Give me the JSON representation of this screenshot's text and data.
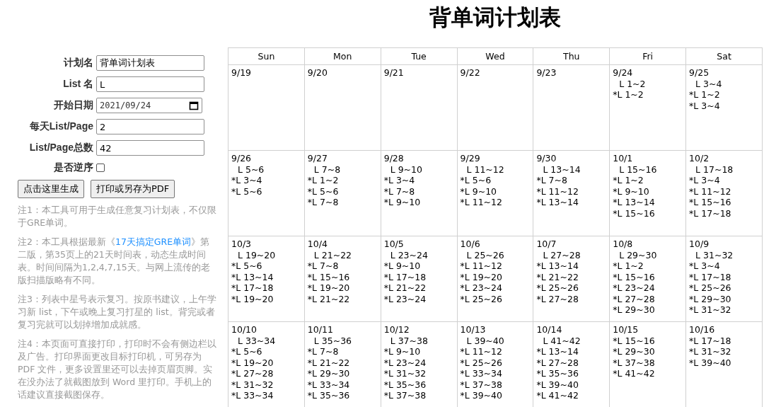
{
  "title": "背单词计划表",
  "form": {
    "fields": [
      {
        "label": "计划名",
        "kind": "text",
        "value": "背单词计划表"
      },
      {
        "label": "List 名",
        "kind": "text",
        "value": "L"
      },
      {
        "label": "开始日期",
        "kind": "date",
        "value": "2021/09/24"
      },
      {
        "label": "每天List/Page",
        "kind": "text",
        "value": "2"
      },
      {
        "label": "List/Page总数",
        "kind": "text",
        "value": "42"
      },
      {
        "label": "是否逆序",
        "kind": "checkbox",
        "checked": false
      }
    ],
    "buttons": [
      "点击这里生成",
      "打印或另存为PDF"
    ]
  },
  "notes": [
    {
      "parts": [
        {
          "kind": "text",
          "text": "注1：本工具可用于生成任意复习计划表，不仅限于GRE单词。"
        }
      ]
    },
    {
      "parts": [
        {
          "kind": "text",
          "text": "注2：本工具根据最新《"
        },
        {
          "kind": "link",
          "text": "17天搞定GRE单词"
        },
        {
          "kind": "text",
          "text": "》第二版，第35页上的21天时间表，动态生成时间表。时间间隔为1,2,4,7,15天。与网上流传的老版扫描版略有不同。"
        }
      ]
    },
    {
      "parts": [
        {
          "kind": "text",
          "text": "注3：列表中星号表示复习。按原书建议，上午学习新 list，下午或晚上复习打星的 list。背完或者复习完就可以划掉增加成就感。"
        }
      ]
    },
    {
      "parts": [
        {
          "kind": "text",
          "text": "注4：本页面可直接打印，打印时不会有侧边栏以及广告。打印界面更改目标打印机，可另存为 PDF 文件，更多设置里还可以去掉页眉页脚。实在没办法了就截图放到 Word 里打印。手机上的话建议直接截图保存。"
        }
      ]
    }
  ],
  "calendar": {
    "columns": [
      "Sun",
      "Mon",
      "Tue",
      "Wed",
      "Thu",
      "Fri",
      "Sat"
    ],
    "weeks": [
      [
        {
          "date": "9/19"
        },
        {
          "date": "9/20"
        },
        {
          "date": "9/21"
        },
        {
          "date": "9/22"
        },
        {
          "date": "9/23"
        },
        {
          "date": "9/24",
          "entries": [
            {
              "kind": "new",
              "text": "L 1~2"
            },
            {
              "kind": "review",
              "text": "*L 1~2"
            }
          ]
        },
        {
          "date": "9/25",
          "entries": [
            {
              "kind": "new",
              "text": "L 3~4"
            },
            {
              "kind": "review",
              "text": "*L 1~2"
            },
            {
              "kind": "review",
              "text": "*L 3~4"
            }
          ]
        }
      ],
      [
        {
          "date": "9/26",
          "entries": [
            {
              "kind": "new",
              "text": "L 5~6"
            },
            {
              "kind": "review",
              "text": "*L 3~4"
            },
            {
              "kind": "review",
              "text": "*L 5~6"
            }
          ]
        },
        {
          "date": "9/27",
          "entries": [
            {
              "kind": "new",
              "text": "L 7~8"
            },
            {
              "kind": "review",
              "text": "*L 1~2"
            },
            {
              "kind": "review",
              "text": "*L 5~6"
            },
            {
              "kind": "review",
              "text": "*L 7~8"
            }
          ]
        },
        {
          "date": "9/28",
          "entries": [
            {
              "kind": "new",
              "text": "L 9~10"
            },
            {
              "kind": "review",
              "text": "*L 3~4"
            },
            {
              "kind": "review",
              "text": "*L 7~8"
            },
            {
              "kind": "review",
              "text": "*L 9~10"
            }
          ]
        },
        {
          "date": "9/29",
          "entries": [
            {
              "kind": "new",
              "text": "L 11~12"
            },
            {
              "kind": "review",
              "text": "*L 5~6"
            },
            {
              "kind": "review",
              "text": "*L 9~10"
            },
            {
              "kind": "review",
              "text": "*L 11~12"
            }
          ]
        },
        {
          "date": "9/30",
          "entries": [
            {
              "kind": "new",
              "text": "L 13~14"
            },
            {
              "kind": "review",
              "text": "*L 7~8"
            },
            {
              "kind": "review",
              "text": "*L 11~12"
            },
            {
              "kind": "review",
              "text": "*L 13~14"
            }
          ]
        },
        {
          "date": "10/1",
          "entries": [
            {
              "kind": "new",
              "text": "L 15~16"
            },
            {
              "kind": "review",
              "text": "*L 1~2"
            },
            {
              "kind": "review",
              "text": "*L 9~10"
            },
            {
              "kind": "review",
              "text": "*L 13~14"
            },
            {
              "kind": "review",
              "text": "*L 15~16"
            }
          ]
        },
        {
          "date": "10/2",
          "entries": [
            {
              "kind": "new",
              "text": "L 17~18"
            },
            {
              "kind": "review",
              "text": "*L 3~4"
            },
            {
              "kind": "review",
              "text": "*L 11~12"
            },
            {
              "kind": "review",
              "text": "*L 15~16"
            },
            {
              "kind": "review",
              "text": "*L 17~18"
            }
          ]
        }
      ],
      [
        {
          "date": "10/3",
          "entries": [
            {
              "kind": "new",
              "text": "L 19~20"
            },
            {
              "kind": "review",
              "text": "*L 5~6"
            },
            {
              "kind": "review",
              "text": "*L 13~14"
            },
            {
              "kind": "review",
              "text": "*L 17~18"
            },
            {
              "kind": "review",
              "text": "*L 19~20"
            }
          ]
        },
        {
          "date": "10/4",
          "entries": [
            {
              "kind": "new",
              "text": "L 21~22"
            },
            {
              "kind": "review",
              "text": "*L 7~8"
            },
            {
              "kind": "review",
              "text": "*L 15~16"
            },
            {
              "kind": "review",
              "text": "*L 19~20"
            },
            {
              "kind": "review",
              "text": "*L 21~22"
            }
          ]
        },
        {
          "date": "10/5",
          "entries": [
            {
              "kind": "new",
              "text": "L 23~24"
            },
            {
              "kind": "review",
              "text": "*L 9~10"
            },
            {
              "kind": "review",
              "text": "*L 17~18"
            },
            {
              "kind": "review",
              "text": "*L 21~22"
            },
            {
              "kind": "review",
              "text": "*L 23~24"
            }
          ]
        },
        {
          "date": "10/6",
          "entries": [
            {
              "kind": "new",
              "text": "L 25~26"
            },
            {
              "kind": "review",
              "text": "*L 11~12"
            },
            {
              "kind": "review",
              "text": "*L 19~20"
            },
            {
              "kind": "review",
              "text": "*L 23~24"
            },
            {
              "kind": "review",
              "text": "*L 25~26"
            }
          ]
        },
        {
          "date": "10/7",
          "entries": [
            {
              "kind": "new",
              "text": "L 27~28"
            },
            {
              "kind": "review",
              "text": "*L 13~14"
            },
            {
              "kind": "review",
              "text": "*L 21~22"
            },
            {
              "kind": "review",
              "text": "*L 25~26"
            },
            {
              "kind": "review",
              "text": "*L 27~28"
            }
          ]
        },
        {
          "date": "10/8",
          "entries": [
            {
              "kind": "new",
              "text": "L 29~30"
            },
            {
              "kind": "review",
              "text": "*L 1~2"
            },
            {
              "kind": "review",
              "text": "*L 15~16"
            },
            {
              "kind": "review",
              "text": "*L 23~24"
            },
            {
              "kind": "review",
              "text": "*L 27~28"
            },
            {
              "kind": "review",
              "text": "*L 29~30"
            }
          ]
        },
        {
          "date": "10/9",
          "entries": [
            {
              "kind": "new",
              "text": "L 31~32"
            },
            {
              "kind": "review",
              "text": "*L 3~4"
            },
            {
              "kind": "review",
              "text": "*L 17~18"
            },
            {
              "kind": "review",
              "text": "*L 25~26"
            },
            {
              "kind": "review",
              "text": "*L 29~30"
            },
            {
              "kind": "review",
              "text": "*L 31~32"
            }
          ]
        }
      ],
      [
        {
          "date": "10/10",
          "entries": [
            {
              "kind": "new",
              "text": "L 33~34"
            },
            {
              "kind": "review",
              "text": "*L 5~6"
            },
            {
              "kind": "review",
              "text": "*L 19~20"
            },
            {
              "kind": "review",
              "text": "*L 27~28"
            },
            {
              "kind": "review",
              "text": "*L 31~32"
            },
            {
              "kind": "review",
              "text": "*L 33~34"
            }
          ]
        },
        {
          "date": "10/11",
          "entries": [
            {
              "kind": "new",
              "text": "L 35~36"
            },
            {
              "kind": "review",
              "text": "*L 7~8"
            },
            {
              "kind": "review",
              "text": "*L 21~22"
            },
            {
              "kind": "review",
              "text": "*L 29~30"
            },
            {
              "kind": "review",
              "text": "*L 33~34"
            },
            {
              "kind": "review",
              "text": "*L 35~36"
            }
          ]
        },
        {
          "date": "10/12",
          "entries": [
            {
              "kind": "new",
              "text": "L 37~38"
            },
            {
              "kind": "review",
              "text": "*L 9~10"
            },
            {
              "kind": "review",
              "text": "*L 23~24"
            },
            {
              "kind": "review",
              "text": "*L 31~32"
            },
            {
              "kind": "review",
              "text": "*L 35~36"
            },
            {
              "kind": "review",
              "text": "*L 37~38"
            }
          ]
        },
        {
          "date": "10/13",
          "entries": [
            {
              "kind": "new",
              "text": "L 39~40"
            },
            {
              "kind": "review",
              "text": "*L 11~12"
            },
            {
              "kind": "review",
              "text": "*L 25~26"
            },
            {
              "kind": "review",
              "text": "*L 33~34"
            },
            {
              "kind": "review",
              "text": "*L 37~38"
            },
            {
              "kind": "review",
              "text": "*L 39~40"
            }
          ]
        },
        {
          "date": "10/14",
          "entries": [
            {
              "kind": "new",
              "text": "L 41~42"
            },
            {
              "kind": "review",
              "text": "*L 13~14"
            },
            {
              "kind": "review",
              "text": "*L 27~28"
            },
            {
              "kind": "review",
              "text": "*L 35~36"
            },
            {
              "kind": "review",
              "text": "*L 39~40"
            },
            {
              "kind": "review",
              "text": "*L 41~42"
            }
          ]
        },
        {
          "date": "10/15",
          "entries": [
            {
              "kind": "review",
              "text": "*L 15~16"
            },
            {
              "kind": "review",
              "text": "*L 29~30"
            },
            {
              "kind": "review",
              "text": "*L 37~38"
            },
            {
              "kind": "review",
              "text": "*L 41~42"
            }
          ]
        },
        {
          "date": "10/16",
          "entries": [
            {
              "kind": "review",
              "text": "*L 17~18"
            },
            {
              "kind": "review",
              "text": "*L 31~32"
            },
            {
              "kind": "review",
              "text": "*L 39~40"
            }
          ]
        }
      ]
    ]
  }
}
